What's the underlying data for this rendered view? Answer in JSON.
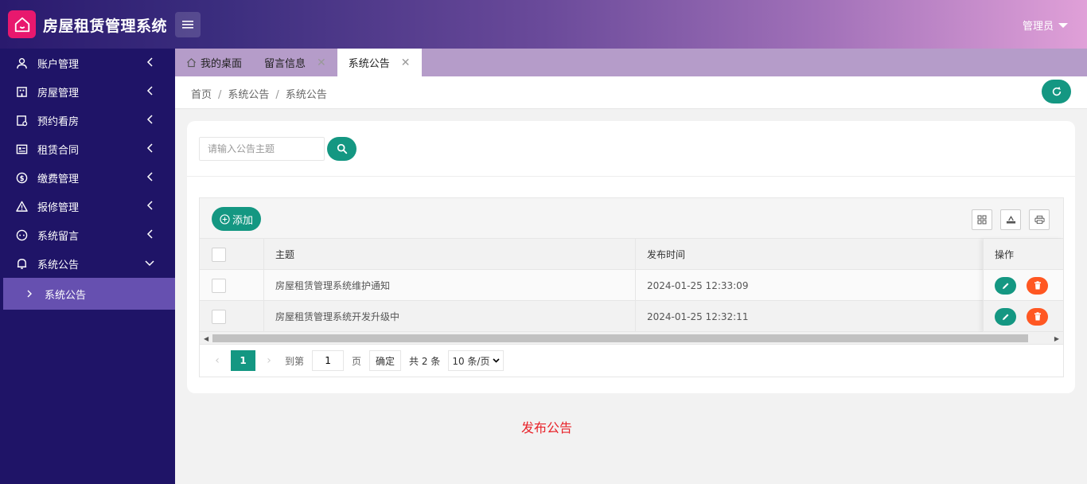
{
  "header": {
    "brand": "房屋租赁管理系统",
    "user_label": "管理员"
  },
  "sidebar": {
    "items": [
      {
        "label": "账户管理",
        "icon": "user-icon"
      },
      {
        "label": "房屋管理",
        "icon": "building-icon"
      },
      {
        "label": "预约看房",
        "icon": "calendar-icon"
      },
      {
        "label": "租赁合同",
        "icon": "contract-icon"
      },
      {
        "label": "缴费管理",
        "icon": "dollar-icon"
      },
      {
        "label": "报修管理",
        "icon": "warning-icon"
      },
      {
        "label": "系统留言",
        "icon": "chat-icon"
      },
      {
        "label": "系统公告",
        "icon": "bell-icon"
      }
    ],
    "active_sub": "系统公告"
  },
  "tabs": [
    {
      "label": "我的桌面"
    },
    {
      "label": "留言信息"
    },
    {
      "label": "系统公告"
    }
  ],
  "breadcrumb": {
    "home": "首页",
    "level1": "系统公告",
    "level2": "系统公告",
    "sep": "/"
  },
  "search": {
    "placeholder": "请输入公告主题"
  },
  "toolbar": {
    "add_label": "添加"
  },
  "table": {
    "columns": [
      "主题",
      "发布时间",
      "操作"
    ],
    "rows": [
      {
        "title": "房屋租赁管理系统维护通知",
        "time": "2024-01-25 12:33:09"
      },
      {
        "title": "房屋租赁管理系统开发升级中",
        "time": "2024-01-25 12:32:11"
      }
    ]
  },
  "pager": {
    "current": "1",
    "goto_label": "到第",
    "page_value": "1",
    "page_unit": "页",
    "confirm": "确定",
    "total": "共 2 条",
    "page_size": "10 条/页"
  },
  "footer_note": "发布公告",
  "colors": {
    "accent": "#149782",
    "danger": "#ff5722",
    "sidebar_bg": "#1f1467",
    "sidebar_active": "#6650b0"
  }
}
